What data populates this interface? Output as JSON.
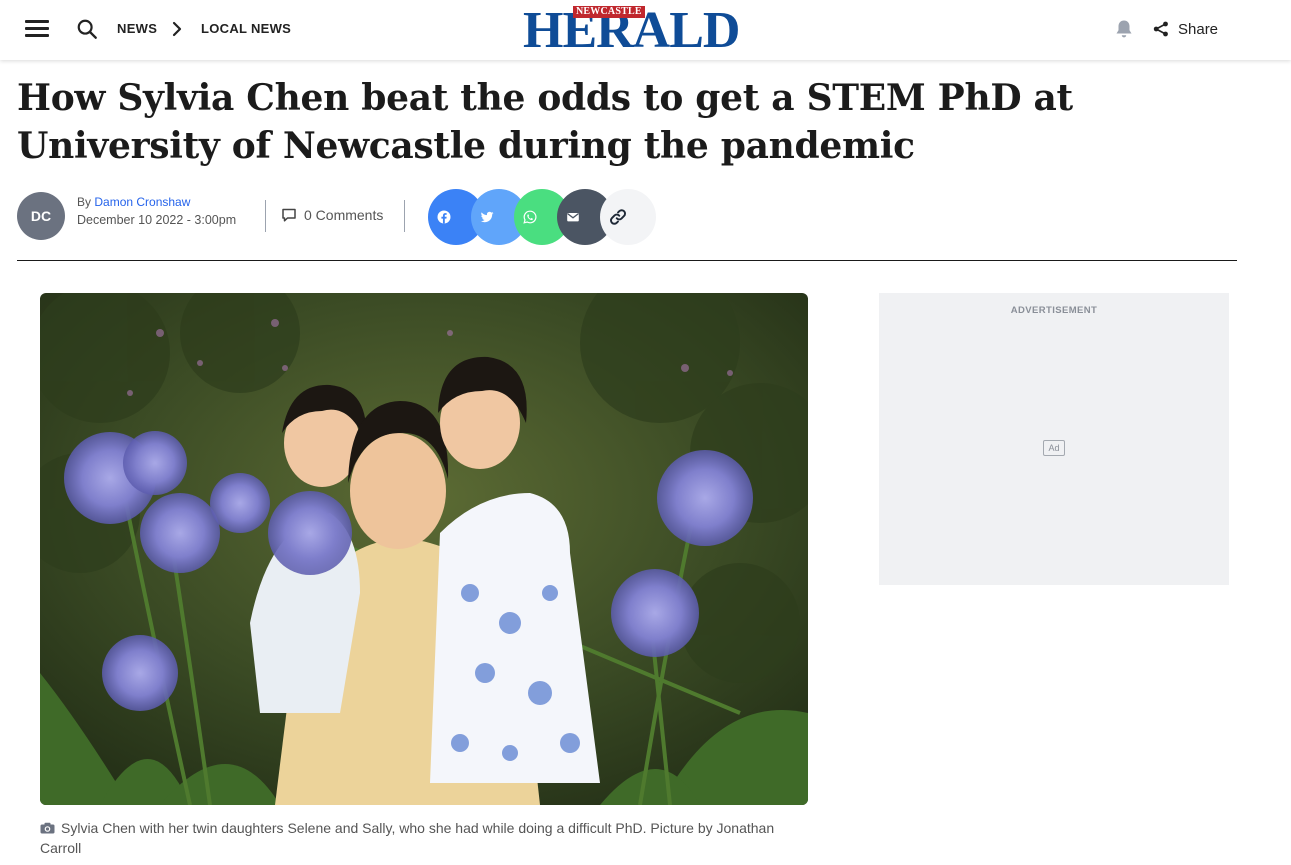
{
  "header": {
    "breadcrumb": [
      "NEWS",
      "LOCAL NEWS"
    ],
    "logo": {
      "small": "NEWCASTLE",
      "main": "HERALD"
    },
    "share_label": "Share",
    "icons": [
      "menu-icon",
      "search-icon",
      "chevron-right-icon",
      "bell-icon",
      "share-icon"
    ]
  },
  "article": {
    "headline": "How Sylvia Chen beat the odds to get a STEM PhD at University of Newcastle during the pandemic",
    "author": {
      "initials": "DC",
      "by_prefix": "By",
      "name": "Damon Cronshaw"
    },
    "date": "December 10 2022 - 3:00pm",
    "comments_label": "0 Comments",
    "share_buttons": [
      "facebook-icon",
      "twitter-icon",
      "whatsapp-icon",
      "email-icon",
      "link-icon"
    ],
    "image_caption": "Sylvia Chen with her twin daughters Selene and Sally, who she had while doing a difficult PhD. Picture by Jonathan Carroll"
  },
  "sidebar": {
    "ad_label": "ADVERTISEMENT",
    "ad_badge": "Ad"
  },
  "colors": {
    "brand_blue": "#0f4c97",
    "brand_red": "#c0272d",
    "link": "#2563eb",
    "facebook": "#3b82f6",
    "twitter": "#60a5fa",
    "whatsapp": "#4ade80",
    "email": "#4b5563",
    "copy_link": "#f3f4f6"
  }
}
